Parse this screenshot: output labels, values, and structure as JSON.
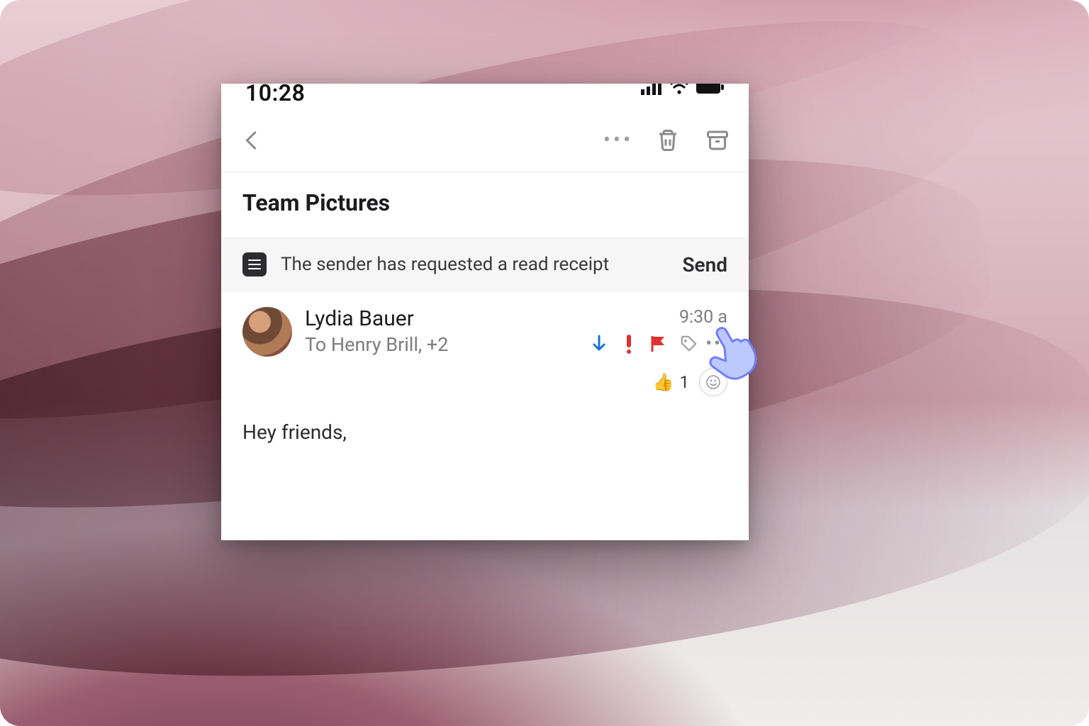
{
  "status": {
    "time": "10:28"
  },
  "thread": {
    "subject": "Team Pictures",
    "receipt": {
      "message": "The sender has requested a read receipt",
      "action": "Send"
    }
  },
  "message": {
    "from": "Lydia Bauer",
    "to_line": "To Henry Brill, +2",
    "timestamp": "9:30 a",
    "reaction": {
      "emoji": "👍",
      "count": "1"
    },
    "body_first_line": "Hey friends,"
  }
}
